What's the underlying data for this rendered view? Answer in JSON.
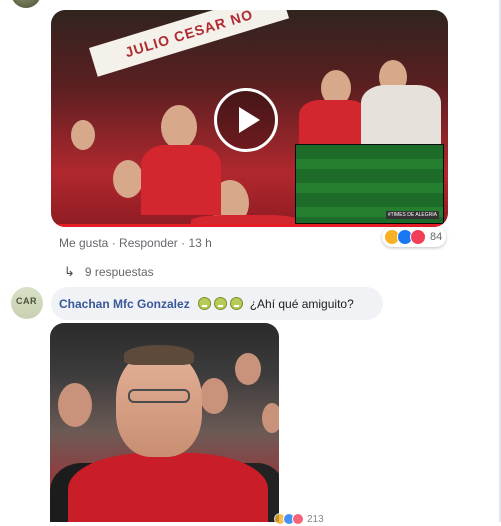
{
  "thread": {
    "first_comment": {
      "media": {
        "banner_text": "JULIO CESAR NO",
        "pip_tag": "#TIMES DE ALEGRIA"
      },
      "actions": {
        "like": "Me gusta",
        "separator": "·",
        "reply": "Responder",
        "time": "13 h"
      },
      "reactions": {
        "types": [
          "haha",
          "like",
          "love"
        ],
        "count": "84"
      },
      "replies": {
        "arrow": "↳",
        "label": "9 respuestas"
      }
    },
    "second_comment": {
      "avatar_text": "CAR",
      "author": "Chachan Mfc Gonzalez",
      "emojis": [
        "nauseated-face",
        "nauseated-face",
        "nauseated-face"
      ],
      "text": "¿Ahí qué amiguito?",
      "bottom_reactions": {
        "types": [
          "haha",
          "like",
          "love"
        ],
        "count": "213"
      }
    }
  },
  "colors": {
    "link": "#385898",
    "meta": "#65676b",
    "bubble": "#f0f2f5",
    "accent_red": "#e41e26"
  }
}
